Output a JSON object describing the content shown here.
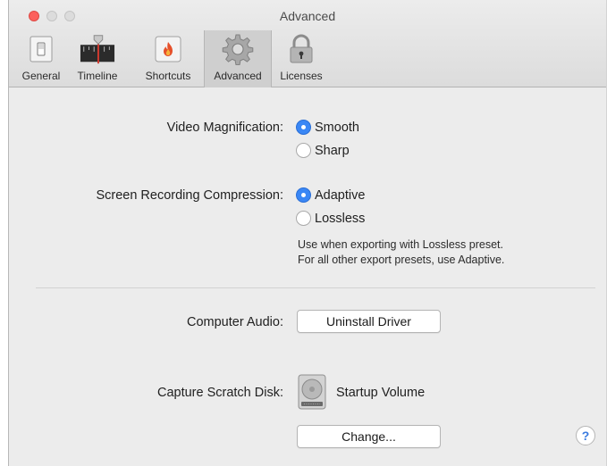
{
  "window": {
    "title": "Advanced"
  },
  "tabs": [
    {
      "label": "General",
      "icon": "switch-icon",
      "active": false
    },
    {
      "label": "Timeline",
      "icon": "timeline-icon",
      "active": false
    },
    {
      "label": "Shortcuts",
      "icon": "flame-icon",
      "active": false
    },
    {
      "label": "Advanced",
      "icon": "gear-icon",
      "active": true
    },
    {
      "label": "Licenses",
      "icon": "lock-icon",
      "active": false
    }
  ],
  "video_magnification": {
    "label": "Video Magnification:",
    "options": [
      "Smooth",
      "Sharp"
    ],
    "selected": "Smooth"
  },
  "screen_recording_compression": {
    "label": "Screen Recording Compression:",
    "options": [
      "Adaptive",
      "Lossless"
    ],
    "selected": "Adaptive",
    "note_line1": "Use when exporting with Lossless preset.",
    "note_line2": "For all other export presets, use Adaptive."
  },
  "computer_audio": {
    "label": "Computer Audio:",
    "button": "Uninstall Driver"
  },
  "capture_scratch_disk": {
    "label": "Capture Scratch Disk:",
    "volume": "Startup Volume",
    "button": "Change..."
  },
  "help": {
    "glyph": "?"
  },
  "colors": {
    "accent": "#3a87f5",
    "close": "#fc605c"
  }
}
